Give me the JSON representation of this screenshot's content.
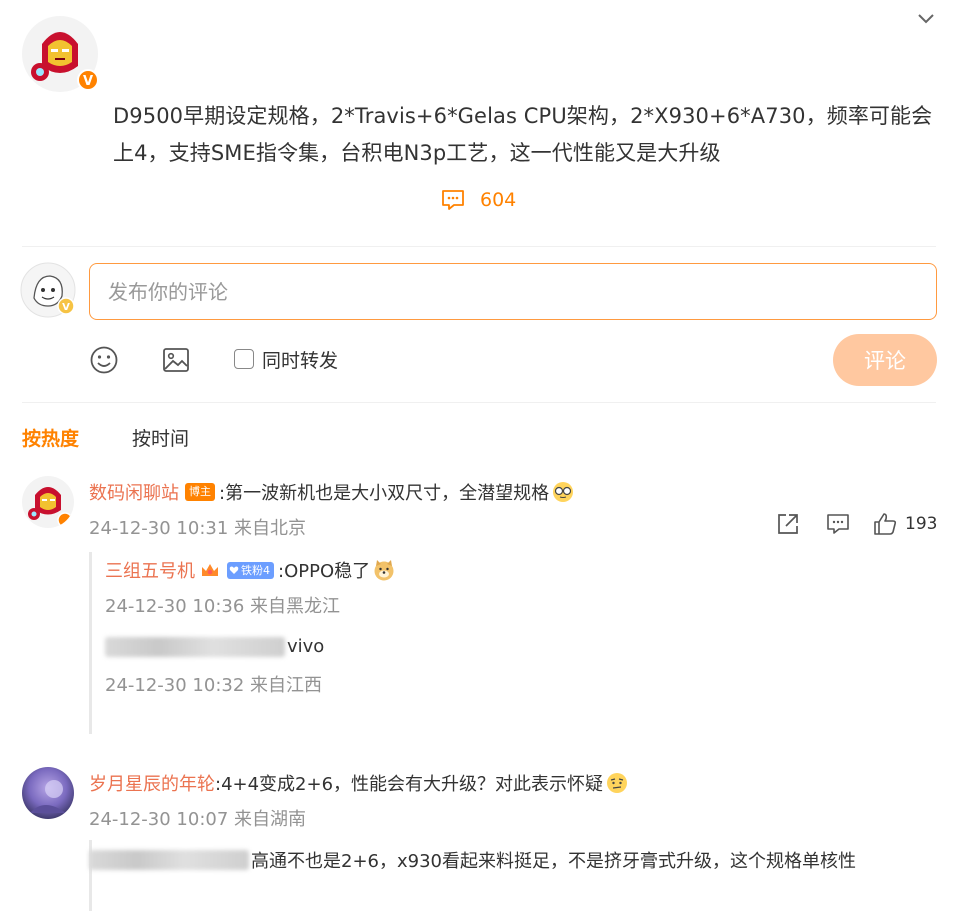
{
  "post": {
    "text": "D9500早期设定规格，2*Travis+6*Gelas CPU架构，2*X930+6*A730，频率可能会上4，支持SME指令集，台积电N3p工艺，这一代性能又是大升级",
    "comment_count": "604"
  },
  "composer": {
    "placeholder": "发布你的评论",
    "repost_label": "同时转发",
    "submit_label": "评论"
  },
  "sort_tabs": {
    "hot": "按热度",
    "time": "按时间"
  },
  "comments": [
    {
      "name": "数码闲聊站",
      "badge": "博主",
      "text": ":第一波新机也是大小双尺寸，全潜望规格",
      "meta": "24-12-30 10:31 来自北京",
      "likes": "193",
      "replies": [
        {
          "name": "三组五号机",
          "fan_badge": "铁粉4",
          "text": ":OPPO稳了",
          "meta": "24-12-30 10:36 来自黑龙江"
        },
        {
          "text_visible": "vivo",
          "meta": "24-12-30 10:32 来自江西"
        }
      ]
    },
    {
      "name": "岁月星辰的年轮",
      "text": ":4+4变成2+6，性能会有大升级？对此表示怀疑",
      "meta": "24-12-30 10:07 来自湖南",
      "reply_text_visible": "高通不也是2+6，x930看起来料挺足，不是挤牙膏式升级，这个规格单核性"
    }
  ],
  "colors": {
    "accent": "#ff8200",
    "name": "#eb7350",
    "meta": "#939393",
    "submit_disabled": "#ffc8a0",
    "fan_badge": "#6c9eff"
  }
}
